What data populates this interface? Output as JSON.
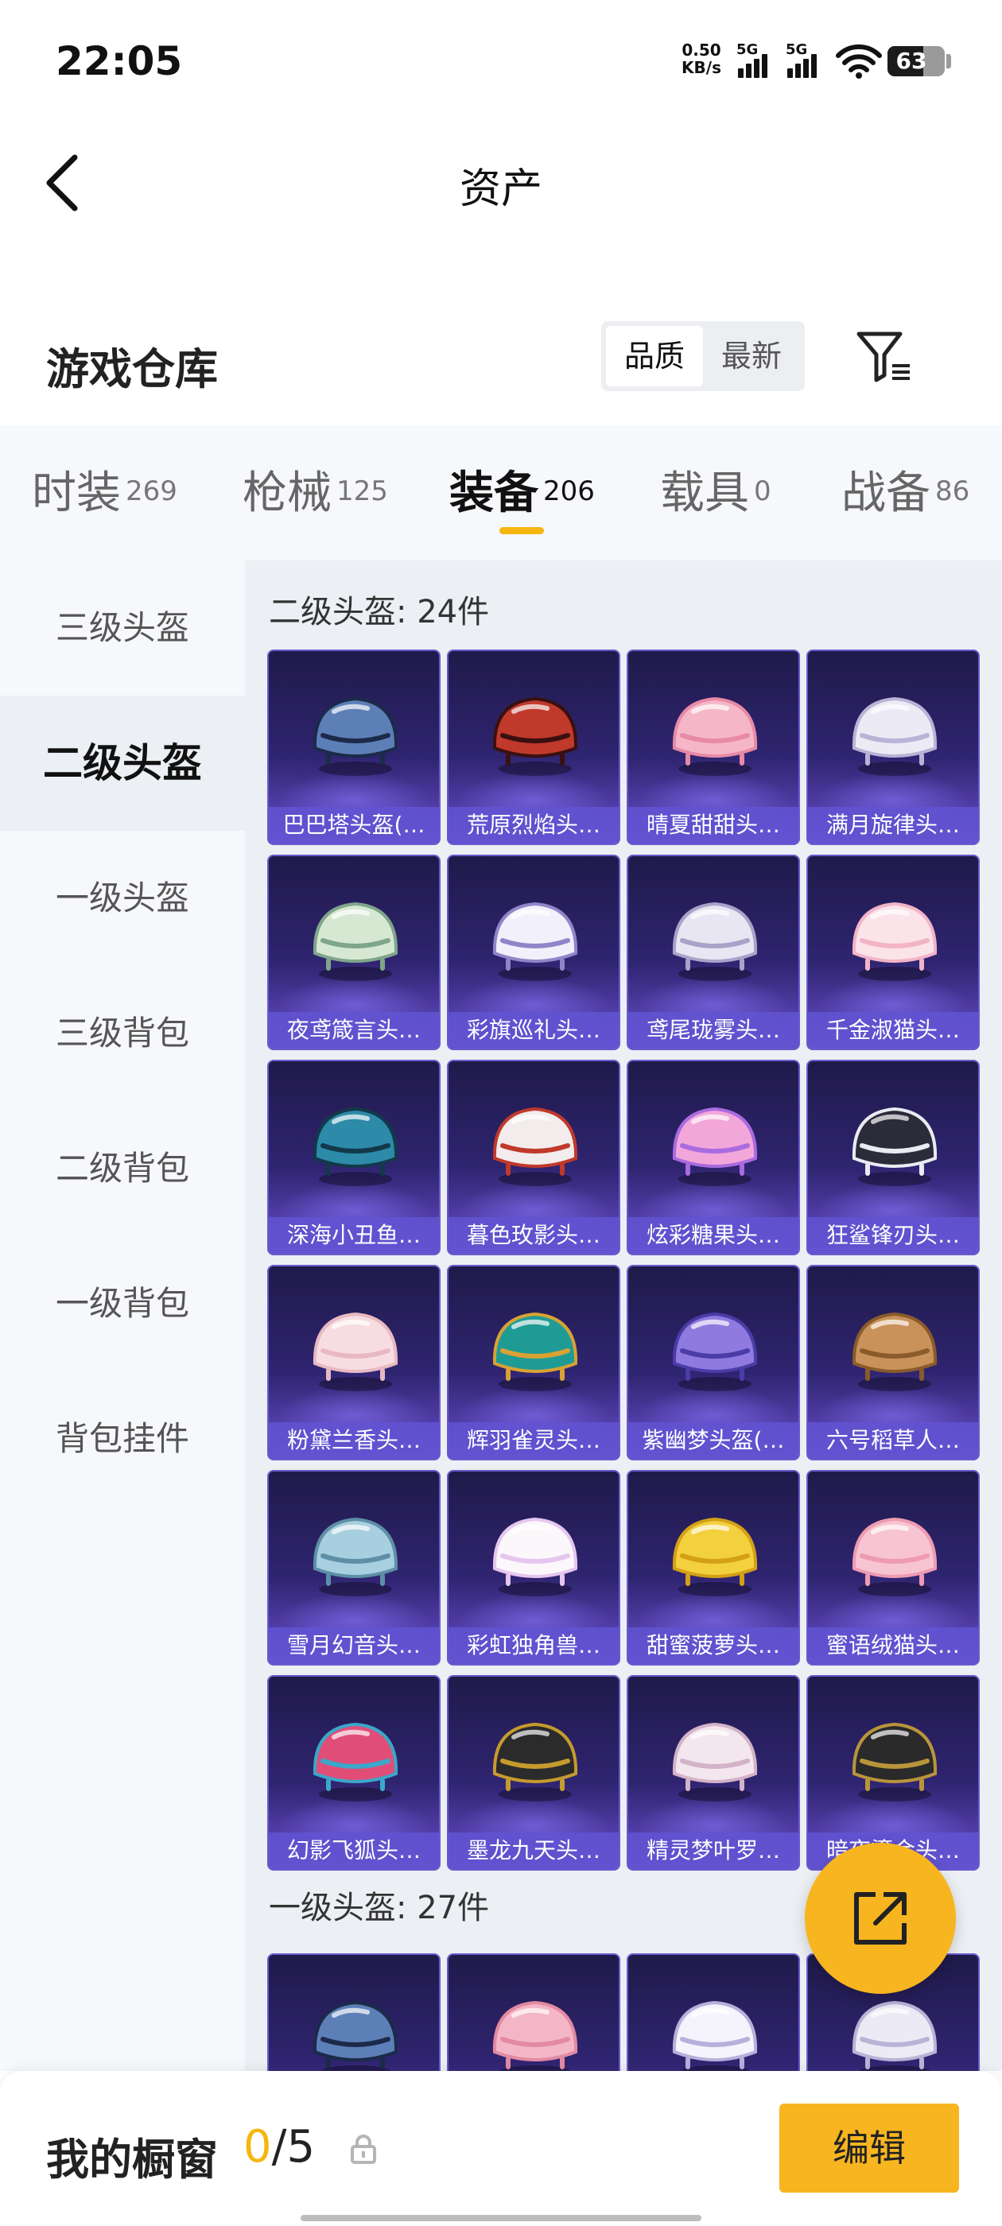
{
  "status_bar": {
    "time": "22:05",
    "net_speed_value": "0.50",
    "net_speed_unit": "KB/s",
    "signal1_tag": "5G",
    "signal2_tag": "5G",
    "battery_level": "63",
    "battery_fraction": 0.63
  },
  "header": {
    "title": "资产"
  },
  "section": {
    "title": "游戏仓库",
    "sort_options": [
      "品质",
      "最新"
    ],
    "sort_selected": "品质"
  },
  "tabs": [
    {
      "label": "时装",
      "count": "269"
    },
    {
      "label": "枪械",
      "count": "125"
    },
    {
      "label": "装备",
      "count": "206"
    },
    {
      "label": "载具",
      "count": "0"
    },
    {
      "label": "战备",
      "count": "86"
    }
  ],
  "active_tab": "装备",
  "sidebar": {
    "items": [
      "三级头盔",
      "二级头盔",
      "一级头盔",
      "三级背包",
      "二级背包",
      "一级背包",
      "背包挂件"
    ],
    "active": "二级头盔"
  },
  "groups": [
    {
      "title": "二级头盔: 24件",
      "items": [
        {
          "name": "巴巴塔头盔(…",
          "colors": [
            "#5d7fb8",
            "#1c2a4a"
          ]
        },
        {
          "name": "荒原烈焰头…",
          "colors": [
            "#c0392b",
            "#3a1010"
          ]
        },
        {
          "name": "晴夏甜甜头…",
          "colors": [
            "#f5b7c8",
            "#e88aa6"
          ]
        },
        {
          "name": "满月旋律头…",
          "colors": [
            "#ecebf5",
            "#b9b3d6"
          ]
        },
        {
          "name": "夜鸢箴言头…",
          "colors": [
            "#d6e8d2",
            "#7fa58b"
          ]
        },
        {
          "name": "彩旗巡礼头…",
          "colors": [
            "#f2f0fa",
            "#8f86c9"
          ]
        },
        {
          "name": "鸢尾珑雾头…",
          "colors": [
            "#e8e6f2",
            "#a9a3c9"
          ]
        },
        {
          "name": "千金淑猫头…",
          "colors": [
            "#fbe3ea",
            "#f2b4c6"
          ]
        },
        {
          "name": "深海小丑鱼…",
          "colors": [
            "#2d8aa8",
            "#12394a"
          ]
        },
        {
          "name": "暮色玫影头…",
          "colors": [
            "#f3ecec",
            "#c0392b"
          ]
        },
        {
          "name": "炫彩糖果头…",
          "colors": [
            "#f3a6d9",
            "#a96be0"
          ]
        },
        {
          "name": "狂鲨锋刃头…",
          "colors": [
            "#2b2b3a",
            "#eaeaf2"
          ]
        },
        {
          "name": "粉黛兰香头…",
          "colors": [
            "#f7dde2",
            "#e8b9c2"
          ]
        },
        {
          "name": "辉羽雀灵头…",
          "colors": [
            "#1f9b95",
            "#d9a233"
          ]
        },
        {
          "name": "紫幽梦头盔(…",
          "colors": [
            "#8f7be0",
            "#4b3ca8"
          ]
        },
        {
          "name": "六号稻草人…",
          "colors": [
            "#c9925a",
            "#8a5b2b"
          ]
        },
        {
          "name": "雪月幻音头…",
          "colors": [
            "#a8cfe0",
            "#5e8fa6"
          ]
        },
        {
          "name": "彩虹独角兽…",
          "colors": [
            "#fbf7fb",
            "#e6c6ef"
          ]
        },
        {
          "name": "甜蜜菠萝头…",
          "colors": [
            "#f3d03e",
            "#d4a017"
          ]
        },
        {
          "name": "蜜语绒猫头…",
          "colors": [
            "#f7c4d1",
            "#ee9bb3"
          ]
        },
        {
          "name": "幻影飞狐头…",
          "colors": [
            "#e04e78",
            "#3ba7c9"
          ]
        },
        {
          "name": "墨龙九天头…",
          "colors": [
            "#2b2b2b",
            "#c59b2e"
          ]
        },
        {
          "name": "精灵梦叶罗…",
          "colors": [
            "#f3e6ee",
            "#d3b3c7"
          ]
        },
        {
          "name": "暗夜鎏金头…",
          "colors": [
            "#2a2a2a",
            "#b9953a"
          ]
        }
      ]
    },
    {
      "title": "一级头盔: 27件",
      "items": [
        {
          "name": "",
          "colors": [
            "#5d7fb8",
            "#1c2a4a"
          ]
        },
        {
          "name": "",
          "colors": [
            "#f3b6c6",
            "#e38aa3"
          ]
        },
        {
          "name": "",
          "colors": [
            "#f5f3fb",
            "#b8b0db"
          ]
        },
        {
          "name": "",
          "colors": [
            "#ecebf5",
            "#b9b3d6"
          ]
        }
      ]
    }
  ],
  "showcase": {
    "label": "我的橱窗",
    "current": "0",
    "total": "/5",
    "edit_label": "编辑"
  }
}
